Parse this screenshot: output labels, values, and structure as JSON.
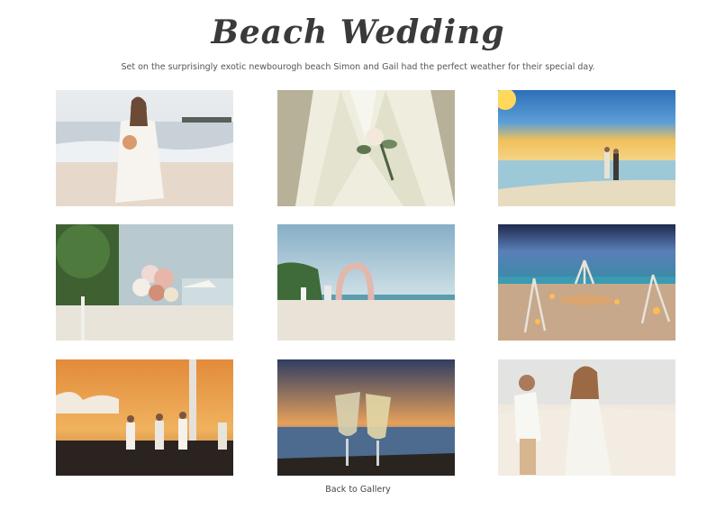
{
  "header": {
    "title": "Beach Wedding",
    "subtitle": "Set on the surprisingly exotic newbourogh beach Simon and Gail had the perfect weather for their special day."
  },
  "gallery": {
    "photos": [
      {
        "subject": "bride-on-beach"
      },
      {
        "subject": "boutonniere"
      },
      {
        "subject": "couple-at-sunset"
      },
      {
        "subject": "floral-arrangement"
      },
      {
        "subject": "beach-arch"
      },
      {
        "subject": "lanterns-tripods"
      },
      {
        "subject": "band-at-sunset"
      },
      {
        "subject": "champagne-toast"
      },
      {
        "subject": "couple-walking"
      }
    ]
  },
  "footer": {
    "back_label": "Back to Gallery"
  }
}
